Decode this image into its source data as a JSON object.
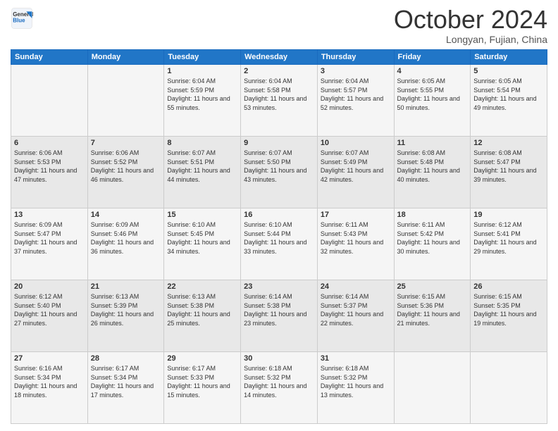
{
  "header": {
    "logo_line1": "General",
    "logo_line2": "Blue",
    "month": "October 2024",
    "location": "Longyan, Fujian, China"
  },
  "days_of_week": [
    "Sunday",
    "Monday",
    "Tuesday",
    "Wednesday",
    "Thursday",
    "Friday",
    "Saturday"
  ],
  "weeks": [
    [
      {
        "day": "",
        "sunrise": "",
        "sunset": "",
        "daylight": ""
      },
      {
        "day": "",
        "sunrise": "",
        "sunset": "",
        "daylight": ""
      },
      {
        "day": "1",
        "sunrise": "Sunrise: 6:04 AM",
        "sunset": "Sunset: 5:59 PM",
        "daylight": "Daylight: 11 hours and 55 minutes."
      },
      {
        "day": "2",
        "sunrise": "Sunrise: 6:04 AM",
        "sunset": "Sunset: 5:58 PM",
        "daylight": "Daylight: 11 hours and 53 minutes."
      },
      {
        "day": "3",
        "sunrise": "Sunrise: 6:04 AM",
        "sunset": "Sunset: 5:57 PM",
        "daylight": "Daylight: 11 hours and 52 minutes."
      },
      {
        "day": "4",
        "sunrise": "Sunrise: 6:05 AM",
        "sunset": "Sunset: 5:55 PM",
        "daylight": "Daylight: 11 hours and 50 minutes."
      },
      {
        "day": "5",
        "sunrise": "Sunrise: 6:05 AM",
        "sunset": "Sunset: 5:54 PM",
        "daylight": "Daylight: 11 hours and 49 minutes."
      }
    ],
    [
      {
        "day": "6",
        "sunrise": "Sunrise: 6:06 AM",
        "sunset": "Sunset: 5:53 PM",
        "daylight": "Daylight: 11 hours and 47 minutes."
      },
      {
        "day": "7",
        "sunrise": "Sunrise: 6:06 AM",
        "sunset": "Sunset: 5:52 PM",
        "daylight": "Daylight: 11 hours and 46 minutes."
      },
      {
        "day": "8",
        "sunrise": "Sunrise: 6:07 AM",
        "sunset": "Sunset: 5:51 PM",
        "daylight": "Daylight: 11 hours and 44 minutes."
      },
      {
        "day": "9",
        "sunrise": "Sunrise: 6:07 AM",
        "sunset": "Sunset: 5:50 PM",
        "daylight": "Daylight: 11 hours and 43 minutes."
      },
      {
        "day": "10",
        "sunrise": "Sunrise: 6:07 AM",
        "sunset": "Sunset: 5:49 PM",
        "daylight": "Daylight: 11 hours and 42 minutes."
      },
      {
        "day": "11",
        "sunrise": "Sunrise: 6:08 AM",
        "sunset": "Sunset: 5:48 PM",
        "daylight": "Daylight: 11 hours and 40 minutes."
      },
      {
        "day": "12",
        "sunrise": "Sunrise: 6:08 AM",
        "sunset": "Sunset: 5:47 PM",
        "daylight": "Daylight: 11 hours and 39 minutes."
      }
    ],
    [
      {
        "day": "13",
        "sunrise": "Sunrise: 6:09 AM",
        "sunset": "Sunset: 5:47 PM",
        "daylight": "Daylight: 11 hours and 37 minutes."
      },
      {
        "day": "14",
        "sunrise": "Sunrise: 6:09 AM",
        "sunset": "Sunset: 5:46 PM",
        "daylight": "Daylight: 11 hours and 36 minutes."
      },
      {
        "day": "15",
        "sunrise": "Sunrise: 6:10 AM",
        "sunset": "Sunset: 5:45 PM",
        "daylight": "Daylight: 11 hours and 34 minutes."
      },
      {
        "day": "16",
        "sunrise": "Sunrise: 6:10 AM",
        "sunset": "Sunset: 5:44 PM",
        "daylight": "Daylight: 11 hours and 33 minutes."
      },
      {
        "day": "17",
        "sunrise": "Sunrise: 6:11 AM",
        "sunset": "Sunset: 5:43 PM",
        "daylight": "Daylight: 11 hours and 32 minutes."
      },
      {
        "day": "18",
        "sunrise": "Sunrise: 6:11 AM",
        "sunset": "Sunset: 5:42 PM",
        "daylight": "Daylight: 11 hours and 30 minutes."
      },
      {
        "day": "19",
        "sunrise": "Sunrise: 6:12 AM",
        "sunset": "Sunset: 5:41 PM",
        "daylight": "Daylight: 11 hours and 29 minutes."
      }
    ],
    [
      {
        "day": "20",
        "sunrise": "Sunrise: 6:12 AM",
        "sunset": "Sunset: 5:40 PM",
        "daylight": "Daylight: 11 hours and 27 minutes."
      },
      {
        "day": "21",
        "sunrise": "Sunrise: 6:13 AM",
        "sunset": "Sunset: 5:39 PM",
        "daylight": "Daylight: 11 hours and 26 minutes."
      },
      {
        "day": "22",
        "sunrise": "Sunrise: 6:13 AM",
        "sunset": "Sunset: 5:38 PM",
        "daylight": "Daylight: 11 hours and 25 minutes."
      },
      {
        "day": "23",
        "sunrise": "Sunrise: 6:14 AM",
        "sunset": "Sunset: 5:38 PM",
        "daylight": "Daylight: 11 hours and 23 minutes."
      },
      {
        "day": "24",
        "sunrise": "Sunrise: 6:14 AM",
        "sunset": "Sunset: 5:37 PM",
        "daylight": "Daylight: 11 hours and 22 minutes."
      },
      {
        "day": "25",
        "sunrise": "Sunrise: 6:15 AM",
        "sunset": "Sunset: 5:36 PM",
        "daylight": "Daylight: 11 hours and 21 minutes."
      },
      {
        "day": "26",
        "sunrise": "Sunrise: 6:15 AM",
        "sunset": "Sunset: 5:35 PM",
        "daylight": "Daylight: 11 hours and 19 minutes."
      }
    ],
    [
      {
        "day": "27",
        "sunrise": "Sunrise: 6:16 AM",
        "sunset": "Sunset: 5:34 PM",
        "daylight": "Daylight: 11 hours and 18 minutes."
      },
      {
        "day": "28",
        "sunrise": "Sunrise: 6:17 AM",
        "sunset": "Sunset: 5:34 PM",
        "daylight": "Daylight: 11 hours and 17 minutes."
      },
      {
        "day": "29",
        "sunrise": "Sunrise: 6:17 AM",
        "sunset": "Sunset: 5:33 PM",
        "daylight": "Daylight: 11 hours and 15 minutes."
      },
      {
        "day": "30",
        "sunrise": "Sunrise: 6:18 AM",
        "sunset": "Sunset: 5:32 PM",
        "daylight": "Daylight: 11 hours and 14 minutes."
      },
      {
        "day": "31",
        "sunrise": "Sunrise: 6:18 AM",
        "sunset": "Sunset: 5:32 PM",
        "daylight": "Daylight: 11 hours and 13 minutes."
      },
      {
        "day": "",
        "sunrise": "",
        "sunset": "",
        "daylight": ""
      },
      {
        "day": "",
        "sunrise": "",
        "sunset": "",
        "daylight": ""
      }
    ]
  ]
}
